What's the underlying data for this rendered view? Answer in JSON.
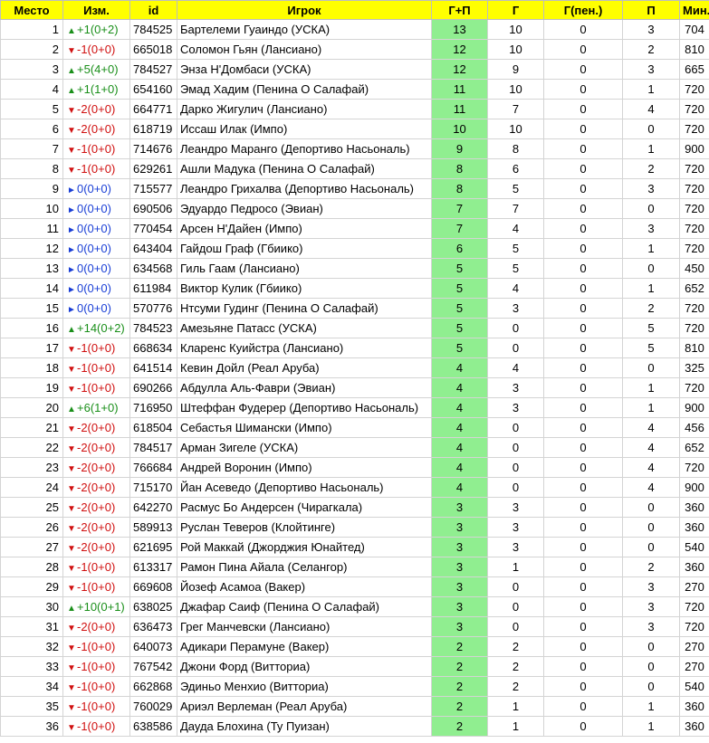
{
  "headers": [
    "Место",
    "Изм.",
    "id",
    "Игрок",
    "Г+П",
    "Г",
    "Г(пен.)",
    "П",
    "Мин."
  ],
  "colors": {
    "header_bg": "#ffff00",
    "gp_bg": "#90ee90",
    "up": "#1a8f1a",
    "down": "#d01010",
    "same": "#1a3fd6"
  },
  "rows": [
    {
      "rank": "1",
      "dir": "up",
      "change": "+1(0+2)",
      "id": "784525",
      "player": "Бартелеми Гуаиндо (УСКА)",
      "gp": "13",
      "g": "10",
      "gpen": "0",
      "a": "3",
      "min": "704"
    },
    {
      "rank": "2",
      "dir": "down",
      "change": "-1(0+0)",
      "id": "665018",
      "player": "Соломон Гьян (Лансиано)",
      "gp": "12",
      "g": "10",
      "gpen": "0",
      "a": "2",
      "min": "810"
    },
    {
      "rank": "3",
      "dir": "up",
      "change": "+5(4+0)",
      "id": "784527",
      "player": "Энза Н'Домбаси (УСКА)",
      "gp": "12",
      "g": "9",
      "gpen": "0",
      "a": "3",
      "min": "665"
    },
    {
      "rank": "4",
      "dir": "up",
      "change": "+1(1+0)",
      "id": "654160",
      "player": "Эмад Хадим (Пенина О Салафай)",
      "gp": "11",
      "g": "10",
      "gpen": "0",
      "a": "1",
      "min": "720"
    },
    {
      "rank": "5",
      "dir": "down",
      "change": "-2(0+0)",
      "id": "664771",
      "player": "Дарко Жигулич (Лансиано)",
      "gp": "11",
      "g": "7",
      "gpen": "0",
      "a": "4",
      "min": "720"
    },
    {
      "rank": "6",
      "dir": "down",
      "change": "-2(0+0)",
      "id": "618719",
      "player": "Иссаш Илак (Импо)",
      "gp": "10",
      "g": "10",
      "gpen": "0",
      "a": "0",
      "min": "720"
    },
    {
      "rank": "7",
      "dir": "down",
      "change": "-1(0+0)",
      "id": "714676",
      "player": "Леандро Маранго (Депортиво Насьональ)",
      "gp": "9",
      "g": "8",
      "gpen": "0",
      "a": "1",
      "min": "900"
    },
    {
      "rank": "8",
      "dir": "down",
      "change": "-1(0+0)",
      "id": "629261",
      "player": "Ашли Мадука (Пенина О Салафай)",
      "gp": "8",
      "g": "6",
      "gpen": "0",
      "a": "2",
      "min": "720"
    },
    {
      "rank": "9",
      "dir": "same",
      "change": "0(0+0)",
      "id": "715577",
      "player": "Леандро Грихалва (Депортиво Насьональ)",
      "gp": "8",
      "g": "5",
      "gpen": "0",
      "a": "3",
      "min": "720"
    },
    {
      "rank": "10",
      "dir": "same",
      "change": "0(0+0)",
      "id": "690506",
      "player": "Эдуардо Педросо (Эвиан)",
      "gp": "7",
      "g": "7",
      "gpen": "0",
      "a": "0",
      "min": "720"
    },
    {
      "rank": "11",
      "dir": "same",
      "change": "0(0+0)",
      "id": "770454",
      "player": "Арсен Н'Дайен (Импо)",
      "gp": "7",
      "g": "4",
      "gpen": "0",
      "a": "3",
      "min": "720"
    },
    {
      "rank": "12",
      "dir": "same",
      "change": "0(0+0)",
      "id": "643404",
      "player": "Гайдош Граф (Гбиико)",
      "gp": "6",
      "g": "5",
      "gpen": "0",
      "a": "1",
      "min": "720"
    },
    {
      "rank": "13",
      "dir": "same",
      "change": "0(0+0)",
      "id": "634568",
      "player": "Гиль Гаам (Лансиано)",
      "gp": "5",
      "g": "5",
      "gpen": "0",
      "a": "0",
      "min": "450"
    },
    {
      "rank": "14",
      "dir": "same",
      "change": "0(0+0)",
      "id": "611984",
      "player": "Виктор Кулик (Гбиико)",
      "gp": "5",
      "g": "4",
      "gpen": "0",
      "a": "1",
      "min": "652"
    },
    {
      "rank": "15",
      "dir": "same",
      "change": "0(0+0)",
      "id": "570776",
      "player": "Нтсуми Гудинг (Пенина О Салафай)",
      "gp": "5",
      "g": "3",
      "gpen": "0",
      "a": "2",
      "min": "720"
    },
    {
      "rank": "16",
      "dir": "up",
      "change": "+14(0+2)",
      "id": "784523",
      "player": "Амезьяне Патасс (УСКА)",
      "gp": "5",
      "g": "0",
      "gpen": "0",
      "a": "5",
      "min": "720"
    },
    {
      "rank": "17",
      "dir": "down",
      "change": "-1(0+0)",
      "id": "668634",
      "player": "Кларенс Куийстра (Лансиано)",
      "gp": "5",
      "g": "0",
      "gpen": "0",
      "a": "5",
      "min": "810"
    },
    {
      "rank": "18",
      "dir": "down",
      "change": "-1(0+0)",
      "id": "641514",
      "player": "Кевин Дойл (Реал Аруба)",
      "gp": "4",
      "g": "4",
      "gpen": "0",
      "a": "0",
      "min": "325"
    },
    {
      "rank": "19",
      "dir": "down",
      "change": "-1(0+0)",
      "id": "690266",
      "player": "Абдулла Аль-Фаври (Эвиан)",
      "gp": "4",
      "g": "3",
      "gpen": "0",
      "a": "1",
      "min": "720"
    },
    {
      "rank": "20",
      "dir": "up",
      "change": "+6(1+0)",
      "id": "716950",
      "player": "Штеффан Фудерер (Депортиво Насьональ)",
      "gp": "4",
      "g": "3",
      "gpen": "0",
      "a": "1",
      "min": "900"
    },
    {
      "rank": "21",
      "dir": "down",
      "change": "-2(0+0)",
      "id": "618504",
      "player": "Себастья Шимански (Импо)",
      "gp": "4",
      "g": "0",
      "gpen": "0",
      "a": "4",
      "min": "456"
    },
    {
      "rank": "22",
      "dir": "down",
      "change": "-2(0+0)",
      "id": "784517",
      "player": "Арман Зигеле (УСКА)",
      "gp": "4",
      "g": "0",
      "gpen": "0",
      "a": "4",
      "min": "652"
    },
    {
      "rank": "23",
      "dir": "down",
      "change": "-2(0+0)",
      "id": "766684",
      "player": "Андрей Воронин (Импо)",
      "gp": "4",
      "g": "0",
      "gpen": "0",
      "a": "4",
      "min": "720"
    },
    {
      "rank": "24",
      "dir": "down",
      "change": "-2(0+0)",
      "id": "715170",
      "player": "Йан Асеведо (Депортиво Насьональ)",
      "gp": "4",
      "g": "0",
      "gpen": "0",
      "a": "4",
      "min": "900"
    },
    {
      "rank": "25",
      "dir": "down",
      "change": "-2(0+0)",
      "id": "642270",
      "player": "Расмус Бо Андерсен (Чирагкала)",
      "gp": "3",
      "g": "3",
      "gpen": "0",
      "a": "0",
      "min": "360"
    },
    {
      "rank": "26",
      "dir": "down",
      "change": "-2(0+0)",
      "id": "589913",
      "player": "Руслан Теверов (Клойтинге)",
      "gp": "3",
      "g": "3",
      "gpen": "0",
      "a": "0",
      "min": "360"
    },
    {
      "rank": "27",
      "dir": "down",
      "change": "-2(0+0)",
      "id": "621695",
      "player": "Рой Маккай (Джорджия Юнайтед)",
      "gp": "3",
      "g": "3",
      "gpen": "0",
      "a": "0",
      "min": "540"
    },
    {
      "rank": "28",
      "dir": "down",
      "change": "-1(0+0)",
      "id": "613317",
      "player": "Рамон Пина Айала (Селангор)",
      "gp": "3",
      "g": "1",
      "gpen": "0",
      "a": "2",
      "min": "360"
    },
    {
      "rank": "29",
      "dir": "down",
      "change": "-1(0+0)",
      "id": "669608",
      "player": "Йозеф Асамоа (Вакер)",
      "gp": "3",
      "g": "0",
      "gpen": "0",
      "a": "3",
      "min": "270"
    },
    {
      "rank": "30",
      "dir": "up",
      "change": "+10(0+1)",
      "id": "638025",
      "player": "Джафар Саиф (Пенина О Салафай)",
      "gp": "3",
      "g": "0",
      "gpen": "0",
      "a": "3",
      "min": "720"
    },
    {
      "rank": "31",
      "dir": "down",
      "change": "-2(0+0)",
      "id": "636473",
      "player": "Грег Манчевски (Лансиано)",
      "gp": "3",
      "g": "0",
      "gpen": "0",
      "a": "3",
      "min": "720"
    },
    {
      "rank": "32",
      "dir": "down",
      "change": "-1(0+0)",
      "id": "640073",
      "player": "Адикари Перамуне (Вакер)",
      "gp": "2",
      "g": "2",
      "gpen": "0",
      "a": "0",
      "min": "270"
    },
    {
      "rank": "33",
      "dir": "down",
      "change": "-1(0+0)",
      "id": "767542",
      "player": "Джони Форд (Витториа)",
      "gp": "2",
      "g": "2",
      "gpen": "0",
      "a": "0",
      "min": "270"
    },
    {
      "rank": "34",
      "dir": "down",
      "change": "-1(0+0)",
      "id": "662868",
      "player": "Эдиньо Менхио (Витториа)",
      "gp": "2",
      "g": "2",
      "gpen": "0",
      "a": "0",
      "min": "540"
    },
    {
      "rank": "35",
      "dir": "down",
      "change": "-1(0+0)",
      "id": "760029",
      "player": "Ариэл Верлеман (Реал Аруба)",
      "gp": "2",
      "g": "1",
      "gpen": "0",
      "a": "1",
      "min": "360"
    },
    {
      "rank": "36",
      "dir": "down",
      "change": "-1(0+0)",
      "id": "638586",
      "player": "Дауда Блохина (Ту Пуизан)",
      "gp": "2",
      "g": "1",
      "gpen": "0",
      "a": "1",
      "min": "360"
    }
  ]
}
